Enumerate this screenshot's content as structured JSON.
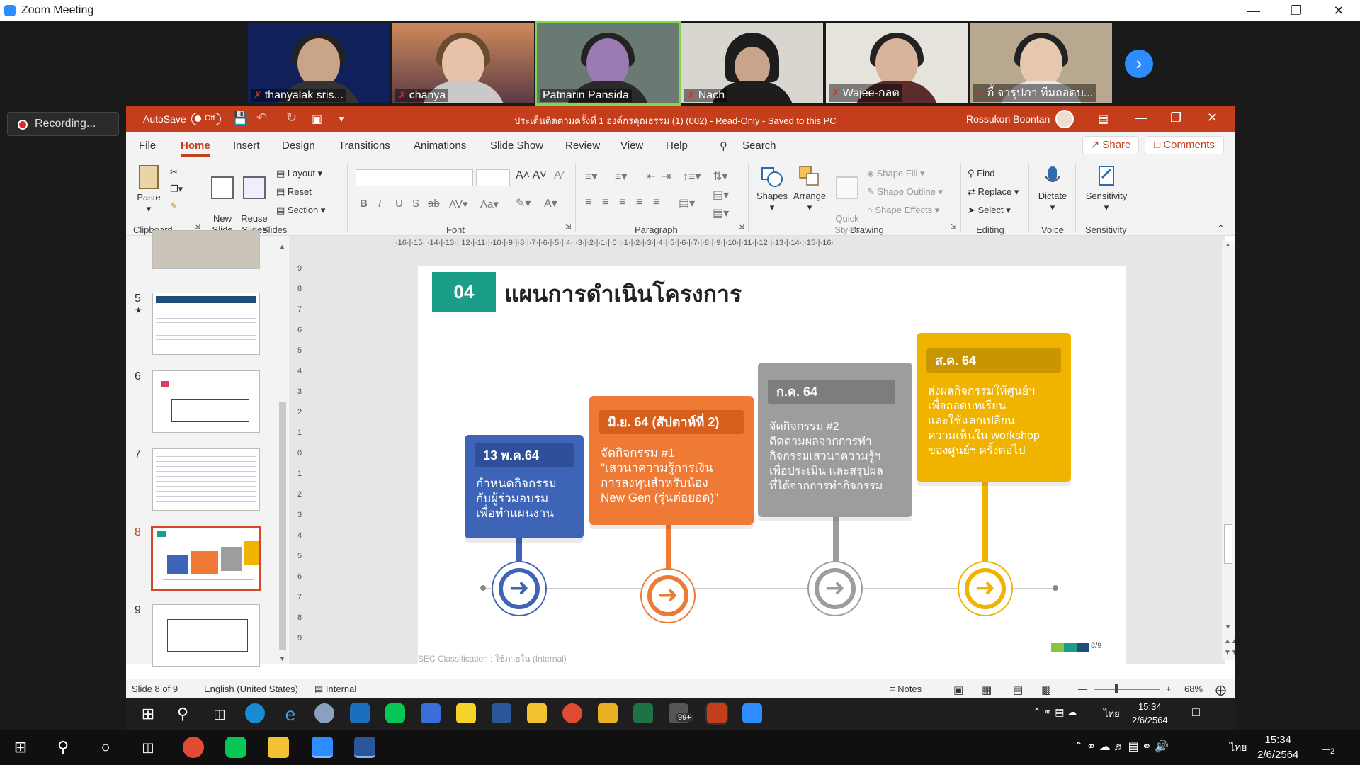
{
  "zoom": {
    "window_title": "Zoom Meeting",
    "recording_label": "Recording...",
    "participants": [
      {
        "name": "thanyalak sris..."
      },
      {
        "name": "chanya"
      },
      {
        "name": "Patnarin Pansida"
      },
      {
        "name": "Nach"
      },
      {
        "name": "Wajee-กลต"
      },
      {
        "name": "กี้ จารุปภา ทีมถอดบ..."
      }
    ]
  },
  "ppt": {
    "autosave_label": "AutoSave",
    "autosave_state": "Off",
    "document_title": "ประเด็นติดตามครั้งที่ 1 องค์กรคุณธรรม (1) (002)  -  Read-Only  -  Saved to this PC",
    "user_name": "Rossukon Boontan",
    "tabs": [
      "File",
      "Home",
      "Insert",
      "Design",
      "Transitions",
      "Animations",
      "Slide Show",
      "Review",
      "View",
      "Help"
    ],
    "active_tab": "Home",
    "search_label": "Search",
    "share_label": "Share",
    "comments_label": "Comments",
    "ribbon": {
      "clipboard": {
        "label": "Clipboard",
        "paste": "Paste"
      },
      "slides": {
        "label": "Slides",
        "new_slide": "New\nSlide",
        "reuse_slides": "Reuse\nSlides",
        "layout": "Layout",
        "reset": "Reset",
        "section": "Section"
      },
      "font": {
        "label": "Font"
      },
      "paragraph": {
        "label": "Paragraph"
      },
      "drawing": {
        "label": "Drawing",
        "shapes": "Shapes",
        "arrange": "Arrange",
        "quick_styles": "Quick\nStyles",
        "shape_fill": "Shape Fill",
        "shape_outline": "Shape Outline",
        "shape_effects": "Shape Effects"
      },
      "editing": {
        "label": "Editing",
        "find": "Find",
        "replace": "Replace",
        "select": "Select"
      },
      "voice": {
        "label": "Voice",
        "dictate": "Dictate"
      },
      "sensitivity": {
        "label": "Sensitivity",
        "sensitivity": "Sensitivity"
      }
    },
    "thumbnails": [
      "5",
      "6",
      "7",
      "8",
      "9"
    ],
    "selected_slide": "8",
    "ruler_h": "·16·|·15·|·14·|·13·|·12·|·11·|·10·|·9·|·8·|·7·|·6·|·5·|·4·|·3·|·2·|·1·|·0·|·1·|·2·|·3·|·4·|·5·|·6·|·7·|·8·|·9·|·10·|·11·|·12·|·13·|·14·|·15·|·16·",
    "ruler_v": [
      "9",
      "8",
      "7",
      "6",
      "5",
      "4",
      "3",
      "2",
      "1",
      "0",
      "1",
      "2",
      "3",
      "4",
      "5",
      "6",
      "7",
      "8",
      "9"
    ],
    "slide": {
      "number_badge": "04",
      "heading": "แผนการดำเนินโครงการ",
      "steps": [
        {
          "date": "13 พ.ค.64",
          "text": "กำหนดกิจกรรม\nกับผู้ร่วมอบรม\nเพื่อทำแผนงาน",
          "color": "#3e64b8",
          "header_color": "#2f4f9a"
        },
        {
          "date": "มิ.ย. 64 (สัปดาห์ที่ 2)",
          "text": "จัดกิจกรรม #1\n\"เสวนาความรู้การเงิน\nการลงทุนสำหรับน้อง\nNew Gen (รุ่นต่อยอด)\"",
          "color": "#ee7a35",
          "header_color": "#d85e1c"
        },
        {
          "date": "ก.ค. 64",
          "text": "จัดกิจกรรม #2\nติดตามผลจากการทำ\nกิจกรรมเสวนาความรู้ฯ\nเพื่อประเมิน และสรุปผล\nที่ได้จากการทำกิจกรรม",
          "color": "#9d9d9d",
          "header_color": "#7d7d7d"
        },
        {
          "date": "ส.ค. 64",
          "text": "ส่งผลกิจกรรมให้ศูนย์ฯ\nเพื่อถอดบทเรียน\nและใช้แลกเปลี่ยน\nความเห็นใน workshop\nของศูนย์ฯ ครั้งต่อไป",
          "color": "#f0b400",
          "header_color": "#c99500"
        }
      ],
      "footer": "SEC Classification : ใช้ภายใน (Internal)",
      "page": "8/9"
    },
    "status": {
      "slide_of": "Slide 8 of 9",
      "language": "English (United States)",
      "classification": "Internal",
      "notes": "Notes",
      "zoom": "68%"
    }
  },
  "inner_taskbar": {
    "time": "15:34",
    "date": "2/6/2564",
    "lang": "ไทย",
    "badge": "99+"
  },
  "outer_taskbar": {
    "time": "15:34",
    "date": "2/6/2564",
    "lang": "ไทย",
    "notif": "2"
  },
  "colors": {
    "ppt_accent": "#c43e1c",
    "zoom_blue": "#2d8cff",
    "teal": "#1a9e8a"
  }
}
